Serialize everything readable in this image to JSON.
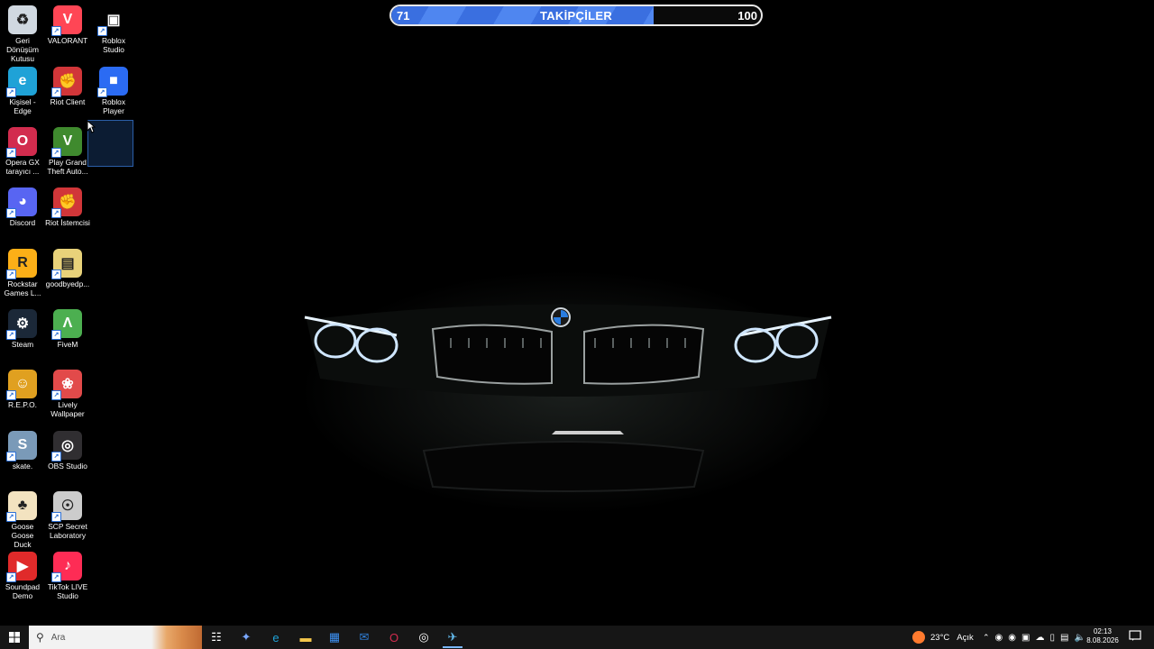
{
  "goal_bar": {
    "current": "71",
    "title": "TAKİPÇİLER",
    "target": "100",
    "progress": 0.71
  },
  "desktop_icons": [
    {
      "label": "Geri\nDönüşüm\nKutusu",
      "icon": "recycle-bin-icon",
      "color": "#d0d8e0"
    },
    {
      "label": "VALORANT",
      "icon": "valorant-icon",
      "color": "#ff4655"
    },
    {
      "label": "Roblox\nStudio",
      "icon": "roblox-studio-icon",
      "color": "#000000"
    },
    {
      "label": "Kişisel - Edge",
      "icon": "edge-icon",
      "color": "#1fa2d7"
    },
    {
      "label": "Riot Client",
      "icon": "riot-client-icon",
      "color": "#d13639"
    },
    {
      "label": "Roblox Player",
      "icon": "roblox-player-icon",
      "color": "#2b6bf3"
    },
    {
      "label": "Opera GX\ntarayıcı ...",
      "icon": "opera-gx-icon",
      "color": "#d22c4e"
    },
    {
      "label": "Play Grand\nTheft Auto...",
      "icon": "gta-icon",
      "color": "#3f8a2e"
    },
    {
      "label": "Discord",
      "icon": "discord-icon",
      "color": "#5865f2"
    },
    {
      "label": "Riot İstemcisi",
      "icon": "riot-client-icon",
      "color": "#d13639"
    },
    {
      "label": "Rockstar\nGames L...",
      "icon": "rockstar-icon",
      "color": "#fcaf17"
    },
    {
      "label": "goodbyedp...",
      "icon": "folder-zip-icon",
      "color": "#e8d27a"
    },
    {
      "label": "Steam",
      "icon": "steam-icon",
      "color": "#1b2838"
    },
    {
      "label": "FiveM",
      "icon": "fivem-icon",
      "color": "#4caf50"
    },
    {
      "label": "R.E.P.O.",
      "icon": "repo-icon",
      "color": "#e0a020"
    },
    {
      "label": "Lively\nWallpaper",
      "icon": "lively-icon",
      "color": "#e24a4a"
    },
    {
      "label": "skate.",
      "icon": "skate-icon",
      "color": "#7a9ab8"
    },
    {
      "label": "OBS Studio",
      "icon": "obs-icon",
      "color": "#302e31"
    },
    {
      "label": "Goose Goose\nDuck",
      "icon": "goose-icon",
      "color": "#f3e3c0"
    },
    {
      "label": "SCP Secret\nLaboratory",
      "icon": "scp-icon",
      "color": "#cccccc"
    },
    {
      "label": "Soundpad\nDemo",
      "icon": "soundpad-icon",
      "color": "#e02a2a"
    },
    {
      "label": "TikTok LIVE\nStudio",
      "icon": "tiktok-live-icon",
      "color": "#fe2c55"
    }
  ],
  "taskbar": {
    "search_placeholder": "Ara",
    "pinned": [
      {
        "icon": "task-view-icon",
        "color": "#ffffff"
      },
      {
        "icon": "copilot-icon",
        "color": "#7aa8ff"
      },
      {
        "icon": "edge-icon",
        "color": "#1fa2d7"
      },
      {
        "icon": "file-explorer-icon",
        "color": "#f3c64b"
      },
      {
        "icon": "store-icon",
        "color": "#3c8ff0"
      },
      {
        "icon": "mail-icon",
        "color": "#2f7fd8"
      },
      {
        "icon": "opera-gx-icon",
        "color": "#d22c4e"
      },
      {
        "icon": "chrome-icon",
        "color": "#ffffff"
      },
      {
        "icon": "steam-icon",
        "color": "#66c0f4"
      }
    ],
    "weather": {
      "temp": "23°C",
      "condition": "Açık"
    },
    "time": "02:13",
    "date": "8.08.2026"
  }
}
